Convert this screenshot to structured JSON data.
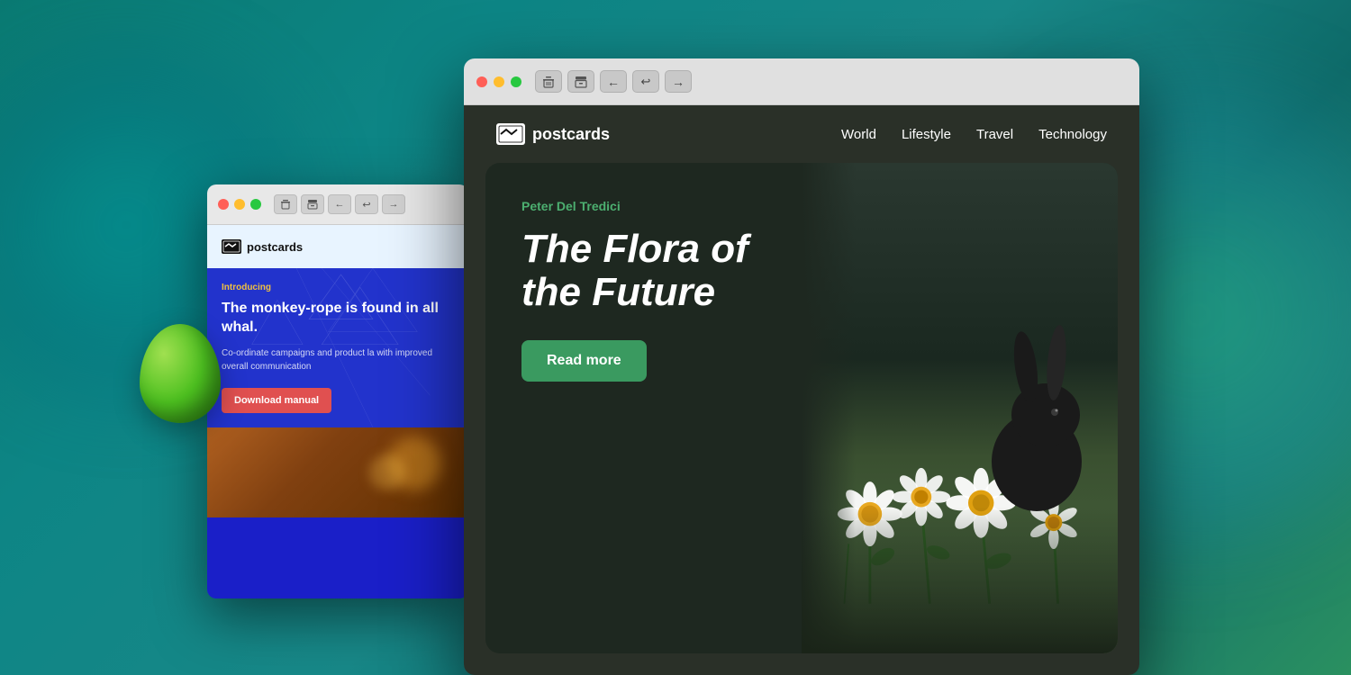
{
  "background": {
    "description": "teal-green gradient background with blobs"
  },
  "window_back": {
    "title": "Email client window - blue",
    "logo": "postcards",
    "introducing_label": "Introducing",
    "headline": "The monkey-rope is found in all whal.",
    "body_text": "Co-ordinate campaigns and product la with improved overall communication",
    "download_btn_label": "Download manual"
  },
  "window_front": {
    "title": "Email client window - dark",
    "toolbar": {
      "delete_icon": "🗑",
      "archive_icon": "🗄",
      "back_icon": "←",
      "back_all_icon": "↩",
      "forward_icon": "→"
    },
    "nav": {
      "logo": "postcards",
      "links": [
        "World",
        "Lifestyle",
        "Travel",
        "Technology"
      ]
    },
    "hero": {
      "author": "Peter Del Tredici",
      "title_line1": "The Flora of",
      "title_line2": "the Future",
      "read_more_label": "Read more"
    }
  }
}
